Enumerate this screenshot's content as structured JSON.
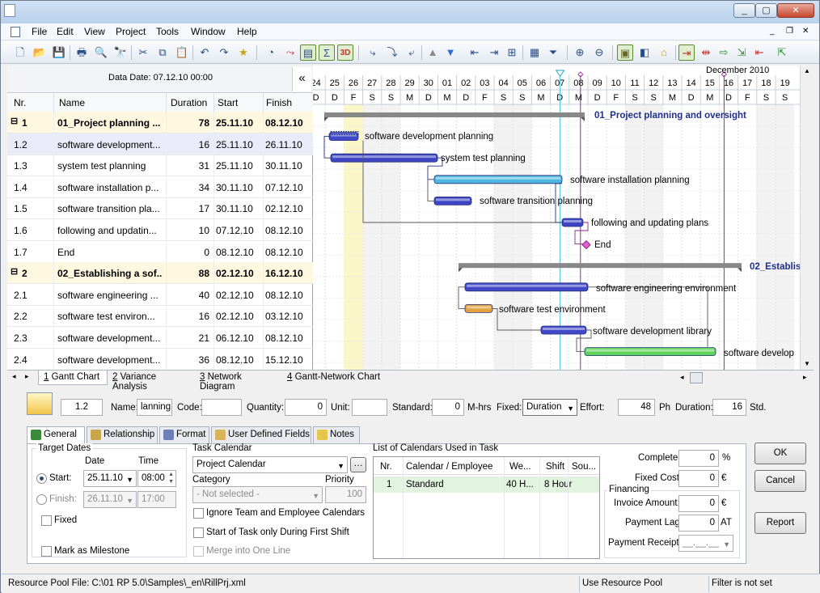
{
  "window": {
    "min": "_",
    "max": "▢",
    "close": "✕"
  },
  "menu": [
    "File",
    "Edit",
    "View",
    "Project",
    "Tools",
    "Window",
    "Help"
  ],
  "mdi": {
    "min": "_",
    "restore": "❐",
    "close": "✕"
  },
  "grid": {
    "data_date": "Data Date: 07.12.10 00:00",
    "collapse": "«",
    "columns": [
      "Nr.",
      "Name",
      "Duration",
      "Start",
      "Finish"
    ],
    "rows": [
      {
        "nr": "1",
        "name": "01_Project planning ...",
        "dur": "78",
        "start": "25.11.10",
        "finish": "08.12.10"
      },
      {
        "nr": "1.2",
        "name": "software development...",
        "dur": "16",
        "start": "25.11.10",
        "finish": "26.11.10"
      },
      {
        "nr": "1.3",
        "name": "system test planning",
        "dur": "31",
        "start": "25.11.10",
        "finish": "30.11.10"
      },
      {
        "nr": "1.4",
        "name": "software installation p...",
        "dur": "34",
        "start": "30.11.10",
        "finish": "07.12.10"
      },
      {
        "nr": "1.5",
        "name": "software transition pla...",
        "dur": "17",
        "start": "30.11.10",
        "finish": "02.12.10"
      },
      {
        "nr": "1.6",
        "name": "following and updatin...",
        "dur": "10",
        "start": "07.12.10",
        "finish": "08.12.10"
      },
      {
        "nr": "1.7",
        "name": "End",
        "dur": "0",
        "start": "08.12.10",
        "finish": "08.12.10"
      },
      {
        "nr": "2",
        "name": "02_Establishing a sof...",
        "dur": "88",
        "start": "02.12.10",
        "finish": "16.12.10"
      },
      {
        "nr": "2.1",
        "name": "software engineering ...",
        "dur": "40",
        "start": "02.12.10",
        "finish": "08.12.10"
      },
      {
        "nr": "2.2",
        "name": "software test environ...",
        "dur": "16",
        "start": "02.12.10",
        "finish": "03.12.10"
      },
      {
        "nr": "2.3",
        "name": "software development...",
        "dur": "21",
        "start": "06.12.10",
        "finish": "08.12.10"
      },
      {
        "nr": "2.4",
        "name": "software development...",
        "dur": "36",
        "start": "08.12.10",
        "finish": "15.12.10"
      }
    ]
  },
  "gantt": {
    "month": "December 2010",
    "days": [
      "24",
      "25",
      "26",
      "27",
      "28",
      "29",
      "30",
      "01",
      "02",
      "03",
      "04",
      "05",
      "06",
      "07",
      "08",
      "09",
      "10",
      "11",
      "12",
      "13",
      "14",
      "15",
      "16",
      "17",
      "18",
      "19"
    ],
    "weekdays": [
      "D",
      "D",
      "F",
      "S",
      "S",
      "M",
      "D",
      "M",
      "D",
      "F",
      "S",
      "S",
      "M",
      "D",
      "M",
      "D",
      "F",
      "S",
      "S",
      "M",
      "D",
      "M",
      "D",
      "F",
      "S",
      "S"
    ],
    "labels": {
      "s1": "01_Project planning and oversight",
      "t12": "software development planning",
      "t13": "system test planning",
      "t14": "software installation planning",
      "t15": "software transition planning",
      "t16": "following and updating plans",
      "t17": "End",
      "s2": "02_Establis",
      "t21": "software engineering environment",
      "t22": "software test environment",
      "t23": "software development library",
      "t24": "software develop"
    }
  },
  "view_tabs": [
    {
      "key": "1",
      "label": " Gantt Chart"
    },
    {
      "key": "2",
      "label": " Variance Analysis"
    },
    {
      "key": "3",
      "label": " Network Diagram"
    },
    {
      "key": "4",
      "label": " Gantt-Network Chart"
    }
  ],
  "edit": {
    "nr": "1.2",
    "name_label": "Name:",
    "name_value": "lanning",
    "code_label": "Code:",
    "qty_label": "Quantity:",
    "qty_value": "0",
    "unit_label": "Unit:",
    "std_label": "Standard:",
    "std_value": "0",
    "std_unit": "M-hrs",
    "fixed_label": "Fixed:",
    "fixed_value": "Duration",
    "effort_label": "Effort:",
    "effort_value": "48",
    "effort_unit": "Ph",
    "duration_label": "Duration:",
    "duration_value": "16",
    "duration_unit": "Std."
  },
  "prop_tabs": [
    "General",
    "Relationship",
    "Format",
    "User Defined Fields",
    "Notes"
  ],
  "general": {
    "target_dates": "Target Dates",
    "date_h": "Date",
    "time_h": "Time",
    "start_label": "Start:",
    "start_date": "25.11.10",
    "start_time": "08:00",
    "finish_label": "Finish:",
    "finish_date": "26.11.10",
    "finish_time": "17:00",
    "fixed": "Fixed",
    "milestone": "Mark as Milestone",
    "calendar_h": "Task Calendar",
    "calendar_value": "Project Calendar",
    "category_h": "Category",
    "category_value": "- Not selected -",
    "priority_h": "Priority",
    "priority_value": "100",
    "ignore": "Ignore Team and Employee Calendars",
    "first_shift": "Start of Task only During First Shift",
    "merge": "Merge into One Line",
    "list_h": "List of Calendars Used in Task",
    "list_cols": [
      "Nr.",
      "Calendar / Employee",
      "We...",
      "Shift",
      "Sou..."
    ],
    "list_row": {
      "nr": "1",
      "cal": "Standard",
      "we": "40 H...",
      "shift": "8 Hour",
      "src": ""
    },
    "complete_label": "Complete:",
    "complete_value": "0",
    "complete_unit": "%",
    "fixedcost_label": "Fixed Cost:",
    "fixedcost_value": "0",
    "fixedcost_unit": "€",
    "financing": "Financing",
    "invoice_label": "Invoice Amount:",
    "invoice_value": "0",
    "invoice_unit": "€",
    "lag_label": "Payment Lag:",
    "lag_value": "0",
    "lag_unit": "AT",
    "receipt_label": "Payment Receipt:",
    "receipt_value": "__.__.__"
  },
  "buttons": {
    "ok": "OK",
    "cancel": "Cancel",
    "report": "Report"
  },
  "status": {
    "file": "Resource Pool File: C:\\01 RP 5.0\\Samples\\_en\\RillPrj.xml",
    "pool": "Use Resource Pool",
    "filter": "Filter is not set"
  }
}
